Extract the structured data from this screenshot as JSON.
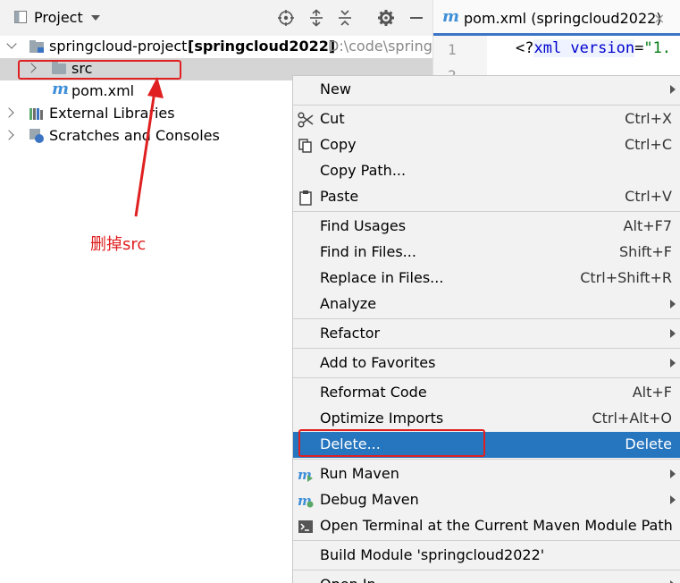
{
  "project_panel": {
    "title": "Project",
    "tree": {
      "root": {
        "name": "springcloud-project",
        "module": "[springcloud2022]",
        "path": "D:\\code\\springc"
      },
      "src": "src",
      "pom": "pom.xml",
      "external_libraries": "External Libraries",
      "scratches": "Scratches and Consoles"
    }
  },
  "annotation": {
    "text": "删掉src",
    "color": "#e02020"
  },
  "editor": {
    "tab_label": "pom.xml (springcloud2022)",
    "tab_close": "×",
    "line_numbers": [
      "1",
      "2"
    ],
    "code_line_1": {
      "open": "<?",
      "attr": "xml version",
      "eq": "=",
      "value": "\"1."
    }
  },
  "context_menu": {
    "items": [
      {
        "label": "New",
        "submenu": true
      },
      {
        "label": "Cut",
        "shortcut": "Ctrl+X",
        "icon": "scissors-icon"
      },
      {
        "label": "Copy",
        "shortcut": "Ctrl+C",
        "icon": "copy-icon"
      },
      {
        "label": "Copy Path...",
        "shortcut": ""
      },
      {
        "label": "Paste",
        "shortcut": "Ctrl+V",
        "icon": "clipboard-icon"
      },
      {
        "label": "Find Usages",
        "shortcut": "Alt+F7"
      },
      {
        "label": "Find in Files...",
        "shortcut": "Shift+F"
      },
      {
        "label": "Replace in Files...",
        "shortcut": "Ctrl+Shift+R"
      },
      {
        "label": "Analyze",
        "submenu": true
      },
      {
        "label": "Refactor",
        "submenu": true
      },
      {
        "label": "Add to Favorites",
        "submenu": true
      },
      {
        "label": "Reformat Code",
        "shortcut": "Alt+F"
      },
      {
        "label": "Optimize Imports",
        "shortcut": "Ctrl+Alt+O"
      },
      {
        "label": "Delete...",
        "shortcut": "Delete",
        "selected": true
      },
      {
        "label": "Run Maven",
        "submenu": true,
        "icon": "maven-run-icon"
      },
      {
        "label": "Debug Maven",
        "submenu": true,
        "icon": "maven-debug-icon"
      },
      {
        "label": "Open Terminal at the Current Maven Module Path",
        "icon": "terminal-icon"
      },
      {
        "label": "Build Module 'springcloud2022'",
        "shortcut": ""
      },
      {
        "label": "Open In",
        "submenu": true
      }
    ],
    "selected_color": "#2675bf"
  }
}
